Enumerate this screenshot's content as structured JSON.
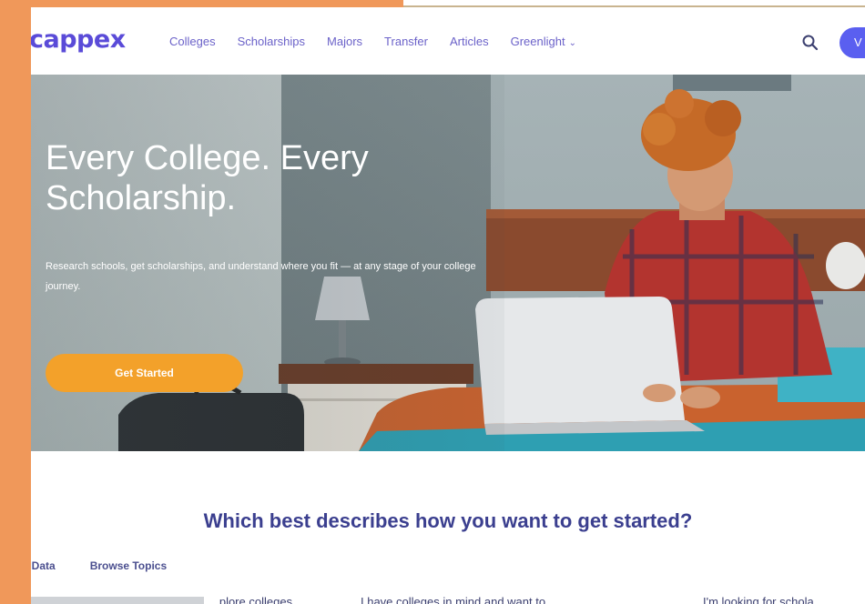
{
  "brand": {
    "logo_text": "cappex",
    "accent": "#5a4bd8",
    "cta_color": "#f3a12a"
  },
  "nav": {
    "links": [
      "Colleges",
      "Scholarships",
      "Majors",
      "Transfer",
      "Articles",
      "Greenlight"
    ],
    "dropdown_icon": "chevron-down-icon",
    "search_icon": "search-icon",
    "cta_label": "V"
  },
  "hero": {
    "title": "Every College. Every Scholarship.",
    "subtitle": "Research schools, get scholarships, and understand where you fit — at any stage of your college journey.",
    "cta_label": "Get Started"
  },
  "prompt": {
    "question": "Which best describes how you want to get started?",
    "tabs": [
      "l Data",
      "Browse Topics"
    ],
    "options": [
      "...plore colleges",
      "I have colleges in mind and want to",
      "I'm looking for schola..."
    ]
  }
}
